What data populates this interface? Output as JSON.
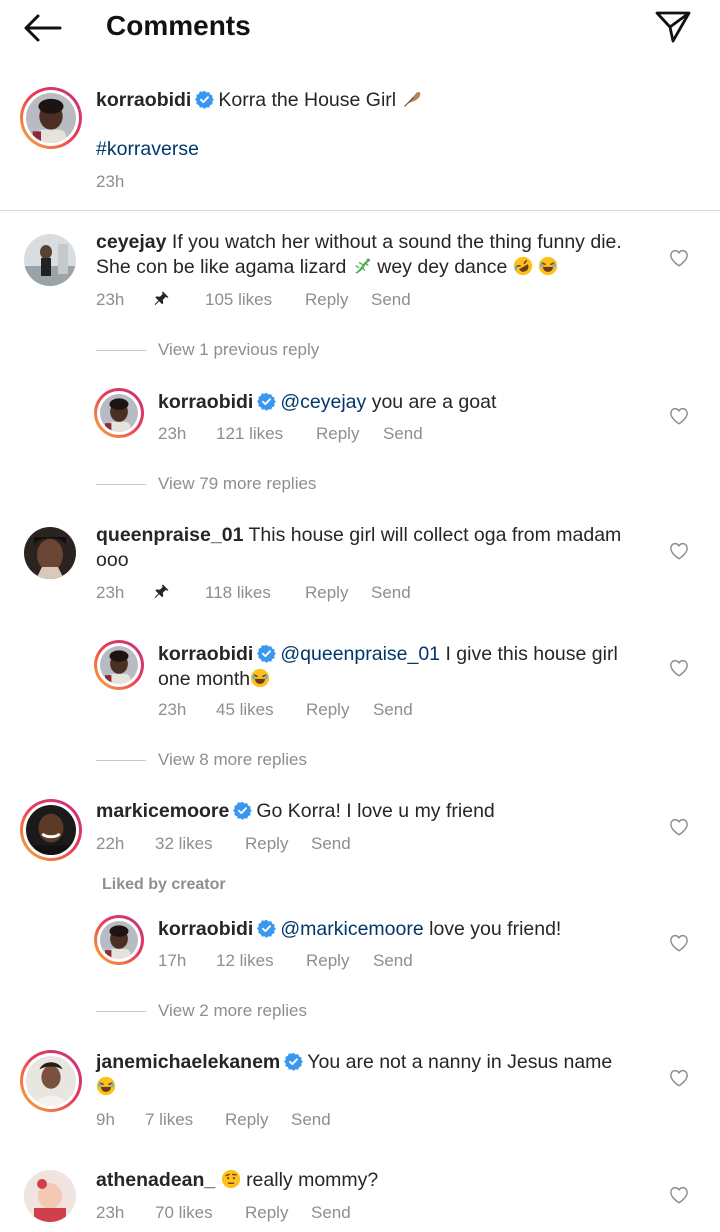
{
  "header": {
    "title": "Comments",
    "back_icon": "back-arrow-icon",
    "share_icon": "paper-plane-icon"
  },
  "caption": {
    "username": "korraobidi",
    "text": "Korra the House Girl",
    "emoji": "feather",
    "hashtag": "#korraverse",
    "time": "23h"
  },
  "comments": [
    {
      "username": "ceyejay",
      "text_line1": "If you watch her without a sound the thing funny die.",
      "text_line2": "She con be like agama lizard",
      "text_line2b": "wey dey dance",
      "time": "23h",
      "likes": "105 likes",
      "reply": "Reply",
      "send": "Send",
      "view_previous": "View 1 previous reply",
      "reply_item": {
        "username": "korraobidi",
        "mention": "@ceyejay",
        "text": "you are a goat",
        "time": "23h",
        "likes": "121 likes",
        "reply": "Reply",
        "send": "Send"
      },
      "view_more": "View 79 more replies"
    },
    {
      "username": "queenpraise_01",
      "text_line1": "This house girl will collect oga from madam",
      "text_line2": "ooo",
      "time": "23h",
      "likes": "118 likes",
      "reply": "Reply",
      "send": "Send",
      "reply_item": {
        "username": "korraobidi",
        "mention": "@queenpraise_01",
        "text": "I give this house girl",
        "text_line2": "one month",
        "time": "23h",
        "likes": "45 likes",
        "reply": "Reply",
        "send": "Send"
      },
      "view_more": "View 8 more replies"
    },
    {
      "username": "markicemoore",
      "text": "Go Korra! I love u my friend",
      "time": "22h",
      "likes": "32 likes",
      "reply": "Reply",
      "send": "Send",
      "liked_by": "Liked by creator",
      "reply_item": {
        "username": "korraobidi",
        "mention": "@markicemoore",
        "text": "love you friend!",
        "time": "17h",
        "likes": "12 likes",
        "reply": "Reply",
        "send": "Send"
      },
      "view_more": "View 2 more replies"
    },
    {
      "username": "janemichaelekanem",
      "text": "You are not a nanny in Jesus name",
      "time": "9h",
      "likes": "7 likes",
      "reply": "Reply",
      "send": "Send"
    },
    {
      "username": "athenadean_",
      "text": "really mommy?",
      "time": "23h",
      "likes": "70 likes",
      "reply": "Reply",
      "send": "Send"
    }
  ],
  "colors": {
    "text": "#262626",
    "meta": "#8e8e8e",
    "link": "#00376b",
    "verified": "#3897f0"
  }
}
